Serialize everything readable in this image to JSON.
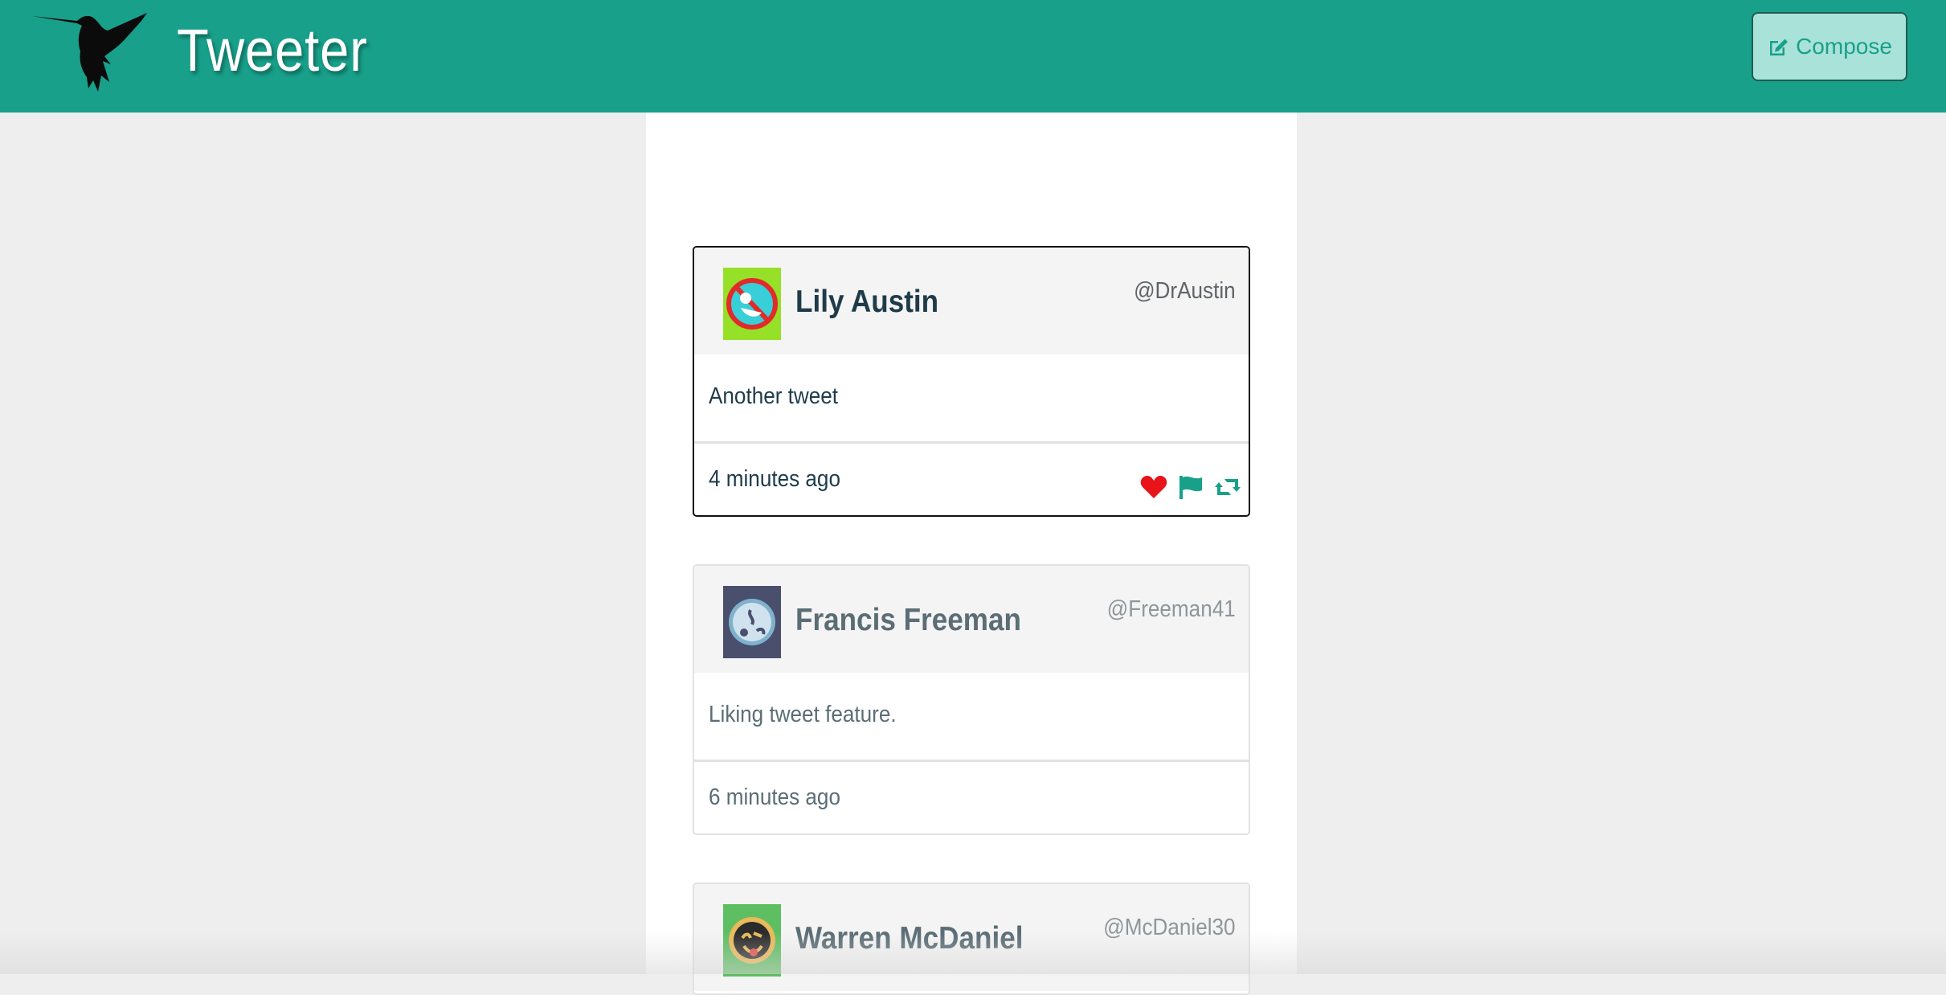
{
  "app": {
    "title": "Tweeter",
    "logo_icon": "hummingbird-icon",
    "accent_color": "#18a08a"
  },
  "header": {
    "compose_label": "Compose",
    "compose_icon": "edit-icon"
  },
  "tweets": [
    {
      "name": "Lily Austin",
      "handle": "@DrAustin",
      "text": "Another tweet",
      "time": "4 minutes ago",
      "avatar_icon": "avatar-identicon",
      "actions": [
        "heart-icon",
        "flag-icon",
        "retweet-icon"
      ]
    },
    {
      "name": "Francis Freeman",
      "handle": "@Freeman41",
      "text": "Liking tweet feature.",
      "time": "6 minutes ago",
      "avatar_icon": "avatar-identicon"
    },
    {
      "name": "Warren McDaniel",
      "handle": "@McDaniel30",
      "avatar_icon": "avatar-identicon"
    }
  ]
}
